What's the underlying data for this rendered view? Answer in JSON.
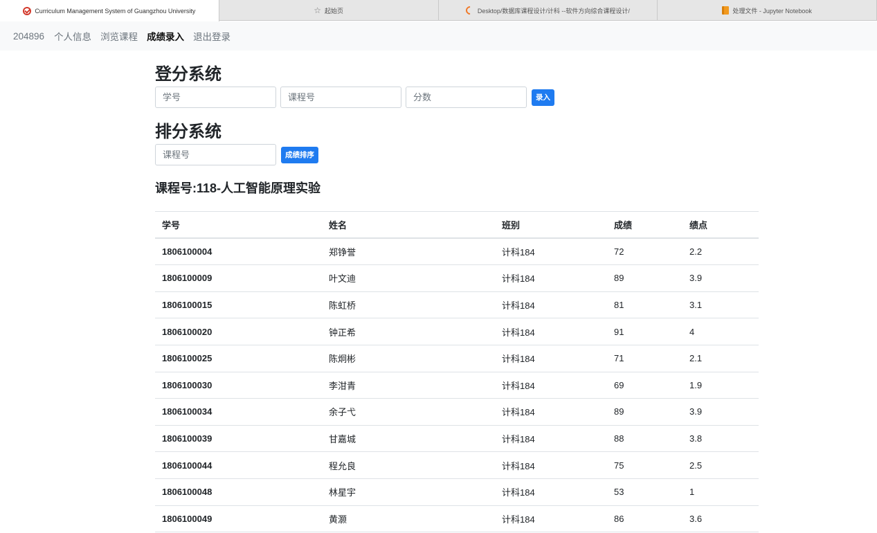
{
  "browser": {
    "tabs": [
      {
        "title": "Curriculum Management System of Guangzhou University",
        "icon": "target-icon",
        "active": true
      },
      {
        "title": "起始页",
        "icon": "star-icon",
        "active": false
      },
      {
        "title": "Desktop/数据库课程设计/计科 --软件方向综合课程设计/",
        "icon": "loading-icon",
        "active": false
      },
      {
        "title": "处理文件 - Jupyter Notebook",
        "icon": "notebook-icon",
        "active": false
      }
    ]
  },
  "navbar": {
    "brand": "204896",
    "links": [
      {
        "label": "个人信息",
        "active": false
      },
      {
        "label": "浏览课程",
        "active": false
      },
      {
        "label": "成绩录入",
        "active": true
      },
      {
        "label": "退出登录",
        "active": false
      }
    ]
  },
  "entry": {
    "title": "登分系统",
    "student_id_placeholder": "学号",
    "course_id_placeholder": "课程号",
    "score_placeholder": "分数",
    "submit_label": "录入"
  },
  "ranking": {
    "title": "排分系统",
    "course_id_placeholder": "课程号",
    "sort_label": "成绩排序"
  },
  "course": {
    "heading": "课程号:118-人工智能原理实验"
  },
  "table": {
    "headers": [
      "学号",
      "姓名",
      "班别",
      "成绩",
      "绩点"
    ],
    "rows": [
      [
        "1806100004",
        "郑铮誉",
        "计科184",
        "72",
        "2.2"
      ],
      [
        "1806100009",
        "叶文迪",
        "计科184",
        "89",
        "3.9"
      ],
      [
        "1806100015",
        "陈虹桥",
        "计科184",
        "81",
        "3.1"
      ],
      [
        "1806100020",
        "钟正希",
        "计科184",
        "91",
        "4"
      ],
      [
        "1806100025",
        "陈炯彬",
        "计科184",
        "71",
        "2.1"
      ],
      [
        "1806100030",
        "李泔青",
        "计科184",
        "69",
        "1.9"
      ],
      [
        "1806100034",
        "余子弋",
        "计科184",
        "89",
        "3.9"
      ],
      [
        "1806100039",
        "甘嘉城",
        "计科184",
        "88",
        "3.8"
      ],
      [
        "1806100044",
        "程允良",
        "计科184",
        "75",
        "2.5"
      ],
      [
        "1806100048",
        "林星宇",
        "计科184",
        "53",
        "1"
      ],
      [
        "1806100049",
        "黄灏",
        "计科184",
        "86",
        "3.6"
      ]
    ]
  },
  "colors": {
    "primary": "#1f7bf0",
    "navbar_bg": "#f8f9fa",
    "muted_text": "#6c757d",
    "border": "#dee2e6"
  }
}
